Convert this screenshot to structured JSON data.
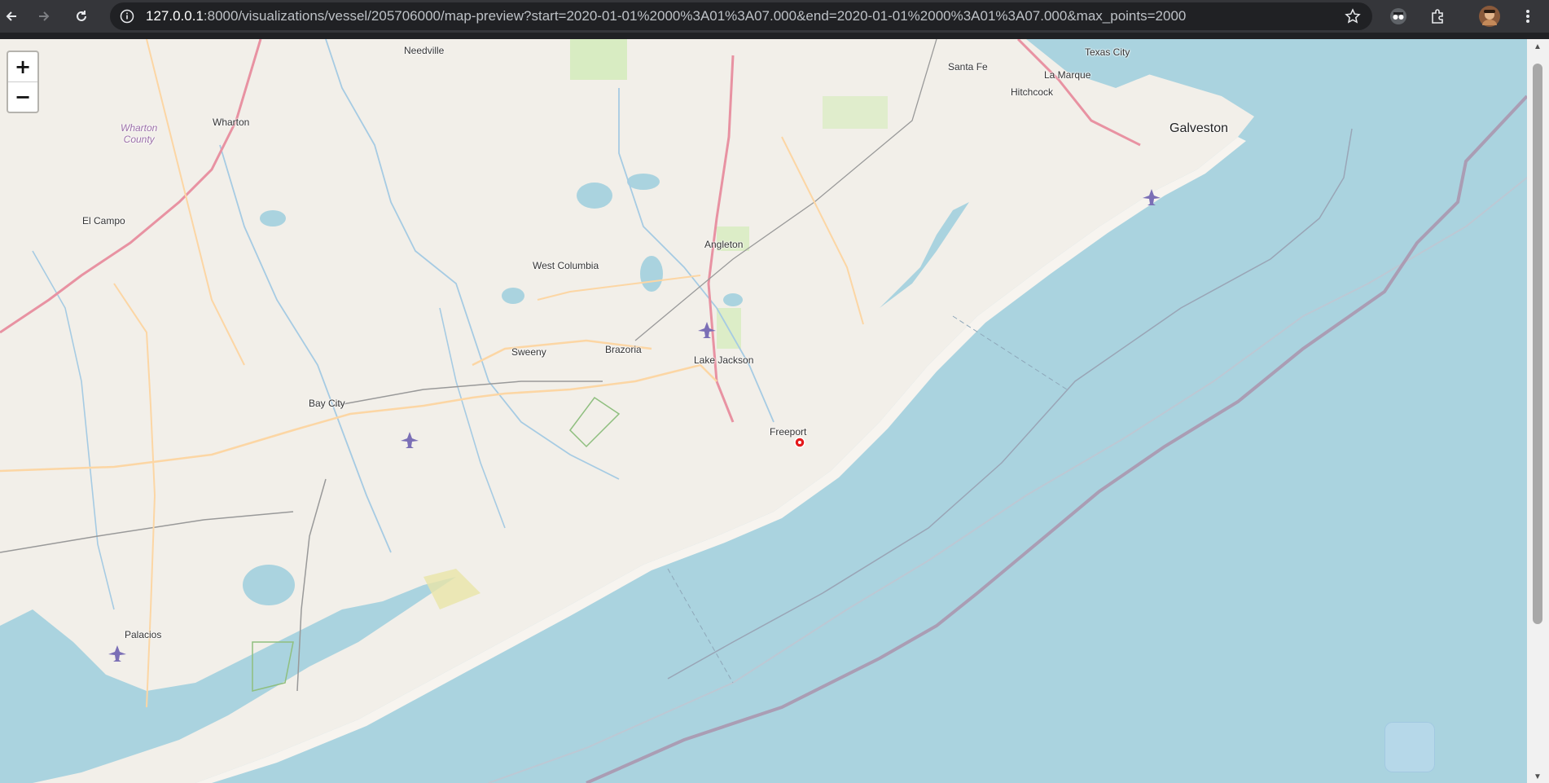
{
  "browser": {
    "url_host": "127.0.0.1",
    "url_path": ":8000/visualizations/vessel/205706000/map-preview?start=2020-01-01%2000%3A01%3A07.000&end=2020-01-01%2000%3A01%3A07.000&max_points=2000",
    "icons": [
      "back-arrow-icon",
      "forward-arrow-icon",
      "reload-icon",
      "info-icon",
      "star-icon",
      "incognito-icon",
      "extensions-icon",
      "profile-avatar",
      "menu-dots-icon"
    ]
  },
  "map": {
    "zoom_in_label": "+",
    "zoom_out_label": "−",
    "places": {
      "needville": "Needville",
      "texas_city": "Texas City",
      "santa_fe": "Santa Fe",
      "la_marque": "La Marque",
      "hitchcock": "Hitchcock",
      "galveston": "Galveston",
      "wharton": "Wharton",
      "wharton_county_1": "Wharton",
      "wharton_county_2": "County",
      "el_campo": "El Campo",
      "angleton": "Angleton",
      "west_columbia": "West Columbia",
      "sweeny": "Sweeny",
      "brazoria": "Brazoria",
      "lake_jackson": "Lake Jackson",
      "bay_city": "Bay City",
      "freeport": "Freeport",
      "palacios": "Palacios"
    },
    "colors": {
      "land": "#f2efe9",
      "water": "#aad3df",
      "motorway": "#e892a2",
      "primary_road": "#fcd6a4",
      "marker": "#e41a1c"
    }
  }
}
